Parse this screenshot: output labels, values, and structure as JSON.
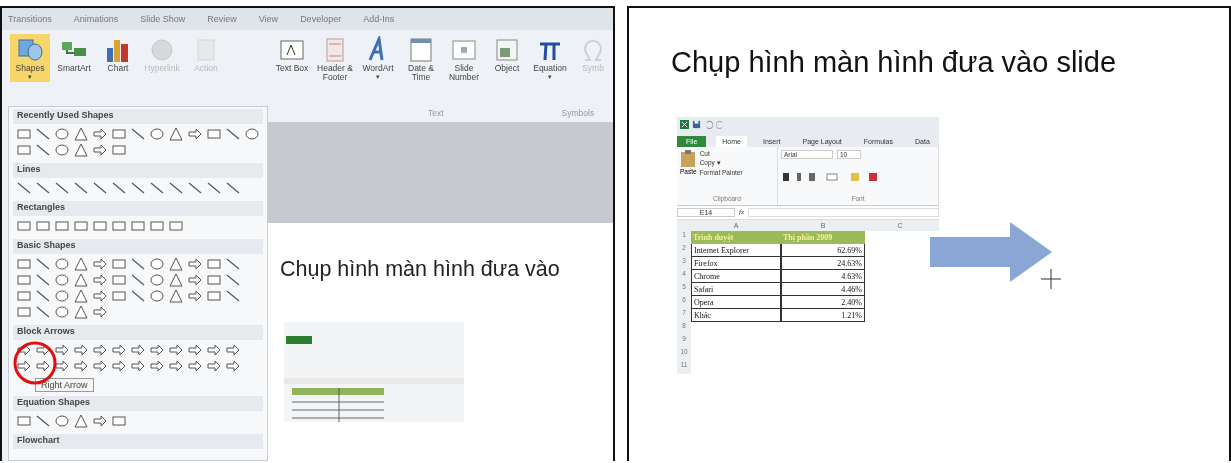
{
  "left_window": {
    "ribbon_tabs": [
      {
        "label": "Transitions",
        "selected": false
      },
      {
        "label": "Animations",
        "selected": false
      },
      {
        "label": "Slide Show",
        "selected": false
      },
      {
        "label": "Review",
        "selected": false
      },
      {
        "label": "View",
        "selected": false
      },
      {
        "label": "Developer",
        "selected": false
      },
      {
        "label": "Add-Ins",
        "selected": false
      }
    ],
    "illustration_buttons": [
      {
        "label": "Shapes",
        "selected": true,
        "disabled": false,
        "dropdown": "▾"
      },
      {
        "label": "SmartArt",
        "selected": false,
        "disabled": false
      },
      {
        "label": "Chart",
        "selected": false,
        "disabled": false
      },
      {
        "label": "Hyperlink",
        "selected": false,
        "disabled": true
      },
      {
        "label": "Action",
        "selected": false,
        "disabled": true
      }
    ],
    "text_buttons": [
      {
        "label": "Text Box",
        "disabled": false
      },
      {
        "label": "Header & Footer",
        "disabled": false
      },
      {
        "label": "WordArt",
        "disabled": false,
        "dropdown": "▾"
      },
      {
        "label": "Date & Time",
        "disabled": false
      },
      {
        "label": "Slide Number",
        "disabled": false
      },
      {
        "label": "Object",
        "disabled": false
      },
      {
        "label": "Equation",
        "disabled": false,
        "dropdown": "▾"
      },
      {
        "label": "Symb",
        "disabled": true
      }
    ],
    "group_labels": [
      "Text",
      "Symbols"
    ],
    "shape_gallery": {
      "sections": [
        {
          "heading": "Recently Used Shapes"
        },
        {
          "heading": "Lines"
        },
        {
          "heading": "Rectangles"
        },
        {
          "heading": "Basic Shapes"
        },
        {
          "heading": "Block Arrows"
        },
        {
          "heading": "Equation Shapes"
        },
        {
          "heading": "Flowchart"
        }
      ],
      "tooltip": "Right Arrow"
    },
    "slide": {
      "title": "Chụp hình màn hình đưa vào"
    }
  },
  "right_slide": {
    "title": "Chụp hình màn hình đưa vào slide",
    "excel": {
      "tabs": [
        {
          "label": "File",
          "kind": "file",
          "selected": false
        },
        {
          "label": "Home",
          "kind": "tab",
          "selected": true
        },
        {
          "label": "Insert",
          "kind": "tab",
          "selected": false
        },
        {
          "label": "Page Layout",
          "kind": "tab",
          "selected": false
        },
        {
          "label": "Formulas",
          "kind": "tab",
          "selected": false
        },
        {
          "label": "Data",
          "kind": "tab",
          "selected": false
        }
      ],
      "paste": "Paste",
      "cut": "Cut",
      "copy": "Copy ▾",
      "format_painter": "Format Painter",
      "clipboard_group": "Clipboard",
      "font_name": "Arial",
      "font_size": "10",
      "font_group": "Font",
      "name_box": "E14",
      "function_label": "fx",
      "columns": [
        "A",
        "B",
        "C"
      ],
      "rows": [
        {
          "number": "1",
          "kind": "header",
          "a": "Trình duyệt",
          "b": "Thị phần 2009"
        },
        {
          "number": "2",
          "kind": "data",
          "a": "Internet Explorer",
          "b": "62.69%"
        },
        {
          "number": "3",
          "kind": "data",
          "a": "Firefox",
          "b": "24.63%"
        },
        {
          "number": "4",
          "kind": "data",
          "a": "Chrome",
          "b": "4.63%"
        },
        {
          "number": "5",
          "kind": "data",
          "a": "Safari",
          "b": "4.46%"
        },
        {
          "number": "6",
          "kind": "data",
          "a": "Opera",
          "b": "2.40%"
        },
        {
          "number": "7",
          "kind": "data",
          "a": "Khác",
          "b": "1.21%"
        },
        {
          "number": "8",
          "kind": "empty"
        },
        {
          "number": "9",
          "kind": "empty"
        },
        {
          "number": "10",
          "kind": "empty"
        },
        {
          "number": "11",
          "kind": "empty"
        }
      ]
    }
  }
}
